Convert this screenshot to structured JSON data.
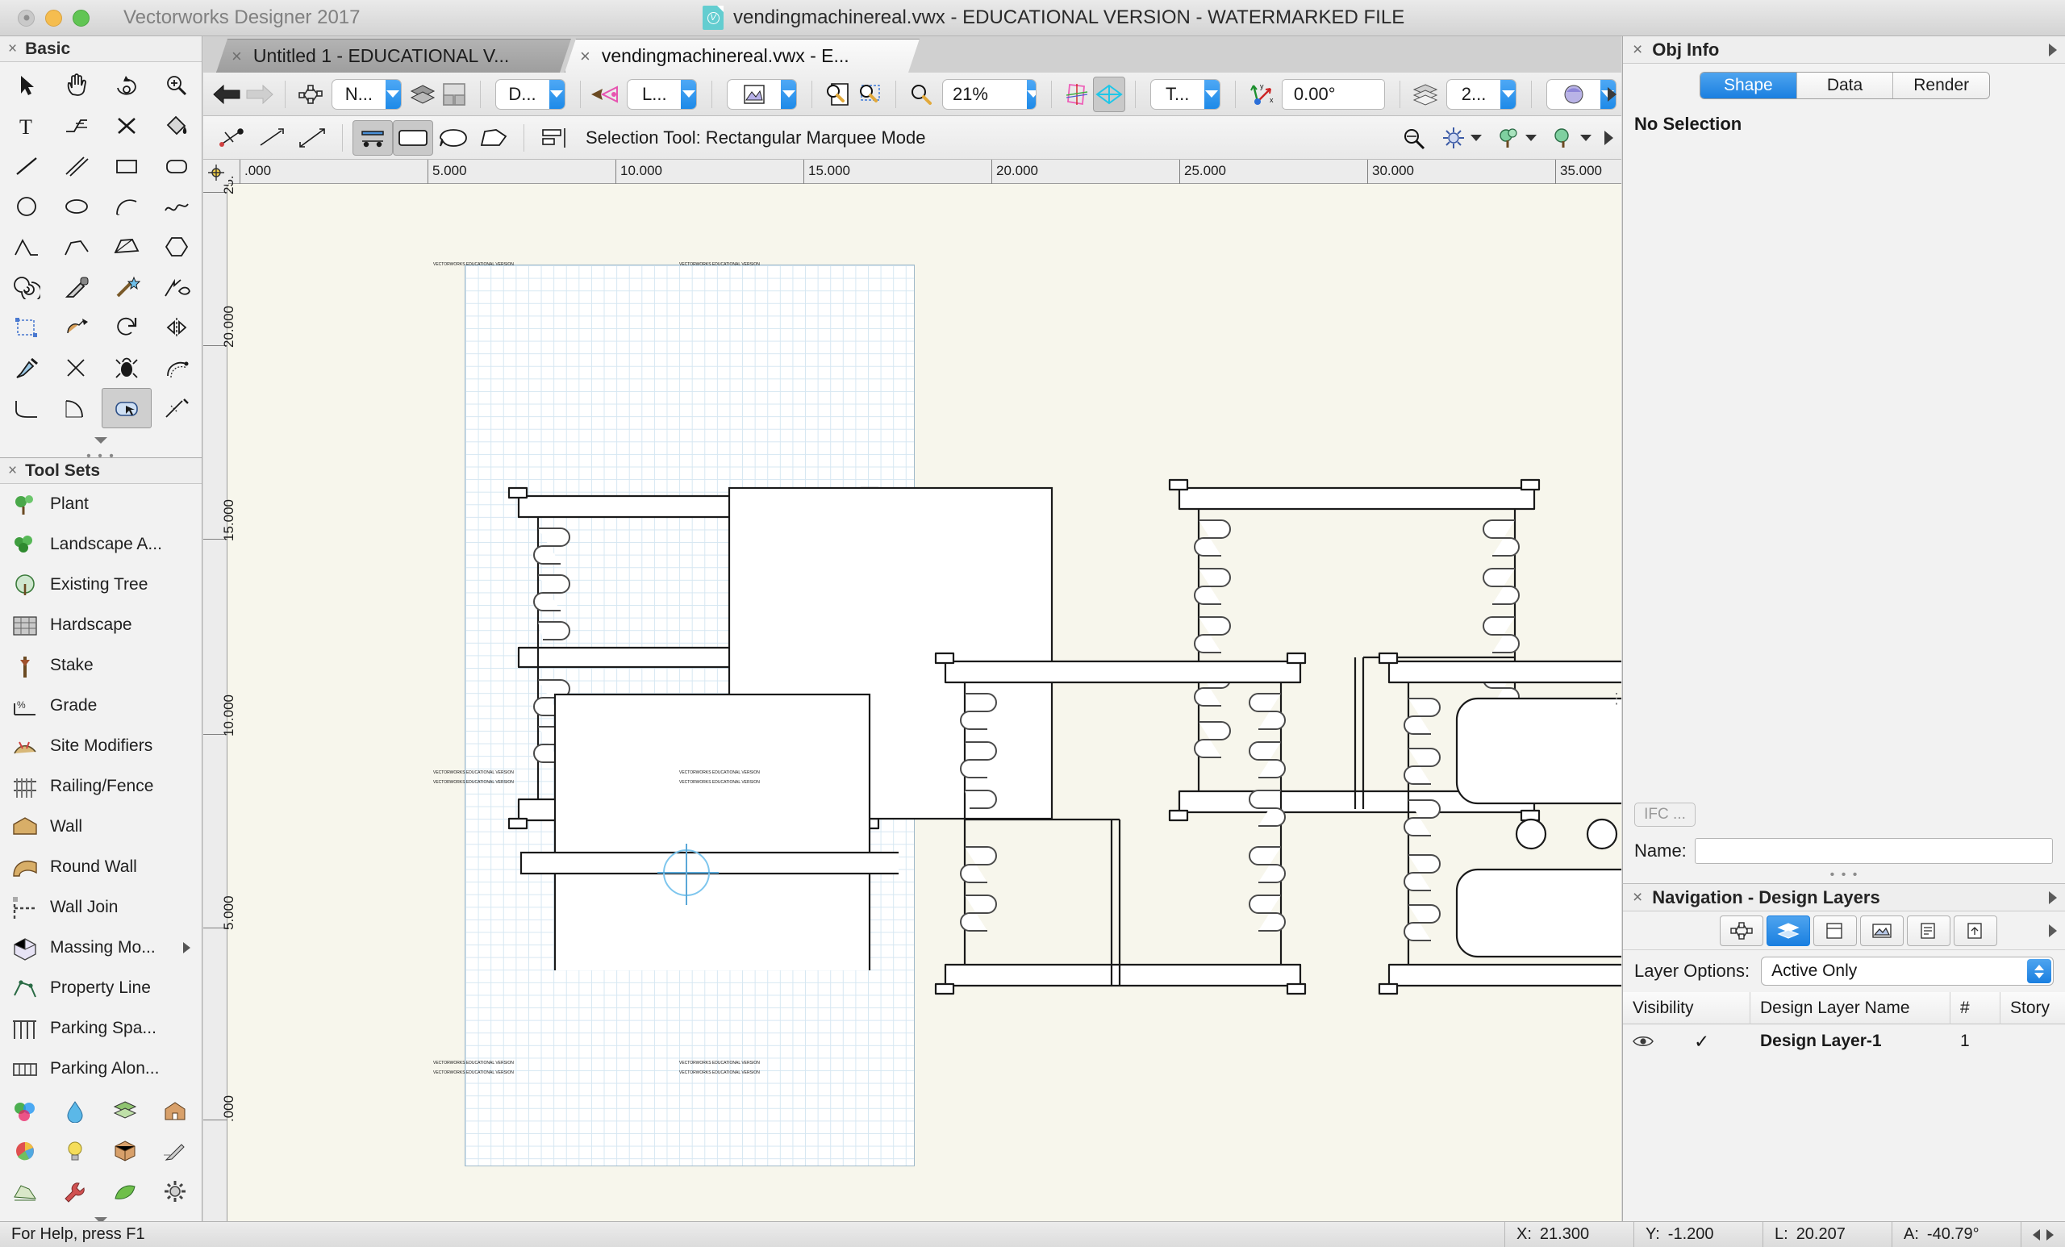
{
  "window": {
    "app_name": "Vectorworks Designer 2017",
    "document_title": "vendingmachinereal.vwx - EDUCATIONAL VERSION - WATERMARKED FILE",
    "doc_icon": "vectorworks-document-icon",
    "traffic_lights": [
      "close",
      "minimize",
      "maximize"
    ]
  },
  "tabs": [
    {
      "label": "Untitled 1 - EDUCATIONAL V...",
      "close": "×",
      "active": false
    },
    {
      "label": "vendingmachinereal.vwx - E...",
      "close": "×",
      "active": true
    }
  ],
  "basic_palette": {
    "title": "Basic",
    "close": "×",
    "tools": [
      "selection-arrow-icon",
      "pan-hand-icon",
      "rotate-view-icon",
      "zoom-in-icon",
      "text-tool-icon",
      "callout-icon",
      "dimension-x-icon",
      "attribute-bucket-icon",
      "line-tool-icon",
      "double-line-icon",
      "rectangle-tool-icon",
      "rounded-rectangle-icon",
      "circle-tool-icon",
      "ellipse-tool-icon",
      "arc-tool-icon",
      "freehand-icon",
      "polyline-peak-icon",
      "chamfer-icon",
      "quad-mesh-icon",
      "polygon-tool-icon",
      "spiral-icon",
      "eyedropper-icon",
      "wand-select-icon",
      "visibility-eye-icon",
      "crop-frame-icon",
      "extrude-icon",
      "rotate-object-icon",
      "mirror-icon",
      "paint-brush-icon",
      "trim-icon",
      "fillet-bug-icon",
      "offset-icon",
      "arc-corner-icon",
      "concave-corner-icon",
      "marquee-select-icon",
      "split-icon"
    ],
    "selected_tool_index": 34,
    "disclosure": "collapse-triangle-icon"
  },
  "tool_sets": {
    "title": "Tool Sets",
    "close": "×",
    "items": [
      {
        "label": "Plant",
        "icon": "plant-icon",
        "submenu": false
      },
      {
        "label": "Landscape A...",
        "icon": "landscape-area-icon",
        "submenu": false
      },
      {
        "label": "Existing Tree",
        "icon": "existing-tree-icon",
        "submenu": false
      },
      {
        "label": "Hardscape",
        "icon": "hardscape-icon",
        "submenu": false
      },
      {
        "label": "Stake",
        "icon": "stake-icon",
        "submenu": false
      },
      {
        "label": "Grade",
        "icon": "grade-icon",
        "submenu": false
      },
      {
        "label": "Site Modifiers",
        "icon": "site-modifiers-icon",
        "submenu": false
      },
      {
        "label": "Railing/Fence",
        "icon": "railing-fence-icon",
        "submenu": false
      },
      {
        "label": "Wall",
        "icon": "wall-icon",
        "submenu": false
      },
      {
        "label": "Round Wall",
        "icon": "round-wall-icon",
        "submenu": false
      },
      {
        "label": "Wall Join",
        "icon": "wall-join-icon",
        "submenu": false
      },
      {
        "label": "Massing Mo...",
        "icon": "massing-model-icon",
        "submenu": true
      },
      {
        "label": "Property Line",
        "icon": "property-line-icon",
        "submenu": false
      },
      {
        "label": "Parking Spa...",
        "icon": "parking-space-icon",
        "submenu": false
      },
      {
        "label": "Parking Alon...",
        "icon": "parking-along-icon",
        "submenu": false
      }
    ],
    "bottom_icons": [
      "attributes-palette-icon",
      "water-drop-icon",
      "layers-stack-icon",
      "building-icon",
      "color-wheel-icon",
      "lightbulb-icon",
      "box-3d-icon",
      "texture-pen-icon",
      "site-plan-icon",
      "wrench-icon",
      "green-shape-icon",
      "gear-icon"
    ],
    "disclosure": "collapse-triangle-icon"
  },
  "view_toolbar": {
    "back": "back-arrow-icon",
    "forward": "forward-arrow-icon",
    "nav_graph": "navigation-graph-icon",
    "class_combo": "N...",
    "layers_icon": "layers-stack-icon",
    "layout_icon": "viewport-layout-icon",
    "layer_combo": "D...",
    "saved_view_icon": "saved-view-icon",
    "saved_view_combo": "L...",
    "render_combo_icon": "render-mode-icon",
    "fit_page_icon": "fit-to-page-icon",
    "fit_objects_icon": "fit-to-objects-icon",
    "zoom_icon": "magnifier-icon",
    "zoom_value": "21%",
    "working_plane_icon": "working-plane-icon",
    "plan_view_icon": "plan-view-icon",
    "view_combo": "T...",
    "axis_icon": "axis-indicator-icon",
    "rotation_value": "0.00°",
    "stack_icon": "stacked-layers-icon",
    "layer_scale_combo": "2...",
    "render_ball_icon": "render-ball-icon",
    "overflow": "toolbar-overflow-arrow"
  },
  "mode_toolbar": {
    "buttons": [
      "snap-to-object-icon",
      "snap-to-line-icon",
      "snap-smart-points-icon",
      "selection-mode-icon",
      "marquee-rect-icon",
      "marquee-lasso-icon",
      "marquee-poly-icon",
      "align-distribute-icon"
    ],
    "selected": [
      "marquee-rect-icon",
      "selection-mode-icon"
    ],
    "status_label": "Selection Tool: Rectangular Marquee Mode",
    "right_buttons": [
      "eyedropper-attr-icon",
      "snapping-settings-icon",
      "smart-cursor-icon",
      "smart-options-icon"
    ],
    "overflow": "toolbar-overflow-arrow"
  },
  "canvas": {
    "origin_icon": "ruler-origin-icon",
    "h_ruler_ticks": [
      ".000",
      "5.000",
      "10.000",
      "15.000",
      "20.000",
      "25.000",
      "30.000",
      "35.000"
    ],
    "v_ruler_ticks": [
      "25.",
      "20.000",
      "15.000",
      "10.000",
      "5.000",
      ".000"
    ],
    "watermark_text": "VECTORWORKS EDUCATIONAL VERSION",
    "cursor": "crosshair-cursor",
    "paper_color": "#ffffff",
    "background_color": "#f7f6ec",
    "grid_color": "#d6e7f2"
  },
  "obj_info": {
    "title": "Obj Info",
    "close": "×",
    "caret": "panel-menu-caret",
    "tabs": [
      {
        "label": "Shape",
        "active": true
      },
      {
        "label": "Data",
        "active": false
      },
      {
        "label": "Render",
        "active": false
      }
    ],
    "status": "No Selection",
    "ifc_button": "IFC ...",
    "name_label": "Name:",
    "name_value": ""
  },
  "navigation": {
    "title": "Navigation - Design Layers",
    "close": "×",
    "caret": "panel-menu-caret",
    "toolbar_icons": [
      "classes-icon",
      "design-layers-icon",
      "sheet-layers-icon",
      "viewports-icon",
      "saved-views-icon",
      "references-icon"
    ],
    "active_icon_index": 1,
    "layer_options_label": "Layer Options:",
    "layer_options_value": "Active Only",
    "columns": [
      "Visibility",
      "Design Layer Name",
      "#",
      "Story"
    ],
    "rows": [
      {
        "visibility_icon": "eye-visible-icon",
        "check": "✓",
        "name": "Design Layer-1",
        "number": "1",
        "story": ""
      }
    ]
  },
  "status_bar": {
    "help_text": "For Help, press F1",
    "fields": [
      {
        "label": "X:",
        "value": "21.300"
      },
      {
        "label": "Y:",
        "value": "-1.200"
      },
      {
        "label": "L:",
        "value": "20.207"
      },
      {
        "label": "A:",
        "value": "-40.79°"
      }
    ],
    "nav_arrows": [
      "prev-arrow-icon",
      "next-arrow-icon"
    ]
  },
  "colors": {
    "accent_blue": "#1a7fe0",
    "panel_bg": "#f2f2f2",
    "canvas_bg": "#f7f6ec",
    "doc_icon_teal": "#63cdd0"
  }
}
